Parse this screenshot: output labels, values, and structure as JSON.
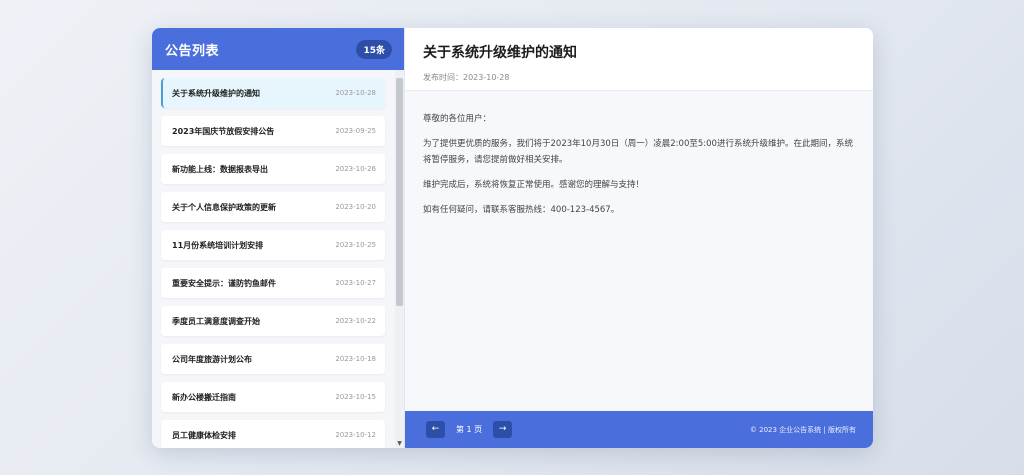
{
  "list_panel": {
    "title": "公告列表",
    "count": "15条",
    "items": [
      {
        "title": "关于系统升级维护的通知",
        "date": "2023-10-28"
      },
      {
        "title": "2023年国庆节放假安排公告",
        "date": "2023-09-25"
      },
      {
        "title": "新功能上线：数据报表导出",
        "date": "2023-10-26"
      },
      {
        "title": "关于个人信息保护政策的更新",
        "date": "2023-10-20"
      },
      {
        "title": "11月份系统培训计划安排",
        "date": "2023-10-25"
      },
      {
        "title": "重要安全提示：谨防钓鱼邮件",
        "date": "2023-10-27"
      },
      {
        "title": "季度员工满意度调查开始",
        "date": "2023-10-22"
      },
      {
        "title": "公司年度旅游计划公布",
        "date": "2023-10-18"
      },
      {
        "title": "新办公楼搬迁指南",
        "date": "2023-10-15"
      },
      {
        "title": "员工健康体检安排",
        "date": "2023-10-12"
      }
    ]
  },
  "detail": {
    "title": "关于系统升级维护的通知",
    "meta": "发布时间：2023-10-28",
    "paragraphs": [
      "尊敬的各位用户：",
      "为了提供更优质的服务，我们将于2023年10月30日（周一）凌晨2:00至5:00进行系统升级维护。在此期间，系统将暂停服务，请您提前做好相关安排。",
      "维护完成后，系统将恢复正常使用。感谢您的理解与支持！",
      "如有任何疑问，请联系客服热线：400-123-4567。"
    ]
  },
  "footer": {
    "prev_label": "←",
    "page_label": "第 1 页",
    "next_label": "→",
    "copyright": "© 2023 企业公告系统 | 版权所有"
  },
  "colors": {
    "accent": "#4a6fdc",
    "accent_dark": "#2e4fa8",
    "active_item_bg": "#e7f6fd"
  },
  "icons": {
    "scroll_down": "chevron-down-icon"
  }
}
